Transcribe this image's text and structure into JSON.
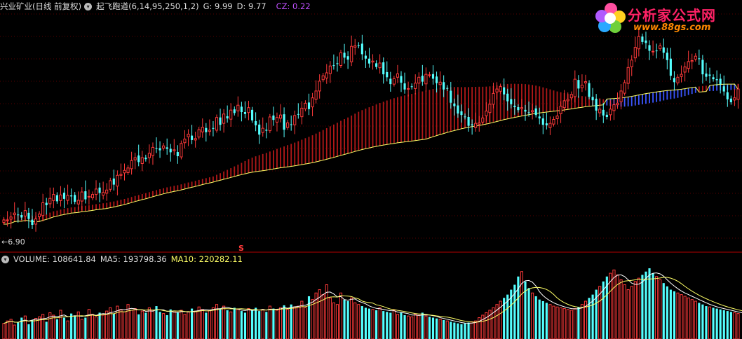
{
  "header": {
    "title": "兴业矿业(日线 前复权)",
    "indicator": "起飞跑道(6,14,95,250,1,2)",
    "g_label": "G: 9.99",
    "d_label": "D: 9.77",
    "cz_label": "CZ: 0.22"
  },
  "volume_header": {
    "volume_label": "VOLUME: 108641.84",
    "ma5_label": "MA5: 193798.36",
    "ma10_label": "MA10: 220282.11"
  },
  "price_panel": {
    "low_marker": "←6.90",
    "s_marker": "S"
  },
  "logo": {
    "title": "分析家公式网",
    "url": "www.88gs.com"
  },
  "colors": {
    "background": "#000000",
    "up": "#ff3a3a",
    "down": "#54ffff",
    "separator": "#b00000",
    "grid": "#5a0000",
    "ribbon_up": "#b01818",
    "ribbon_down": "#3a55ff",
    "ma_yellow": "#ffff66",
    "cz_purple": "#c050ff"
  },
  "chart_data": [
    {
      "type": "candlestick",
      "name": "兴业矿业(日线 前复权)",
      "ylim": [
        6.5,
        11.3
      ],
      "x": [
        1,
        2,
        3,
        4,
        5,
        6,
        7,
        8,
        9,
        10,
        11,
        12,
        13,
        14,
        15,
        16,
        17,
        18,
        19,
        20,
        21,
        22,
        23,
        24,
        25,
        26,
        27,
        28,
        29,
        30,
        31,
        32,
        33,
        34,
        35,
        36,
        37,
        38,
        39,
        40,
        41,
        42,
        43,
        44,
        45,
        46,
        47,
        48,
        49,
        50,
        51,
        52,
        53,
        54,
        55,
        56,
        57,
        58,
        59,
        60,
        61,
        62,
        63,
        64,
        65,
        66,
        67,
        68,
        69,
        70,
        71,
        72,
        73,
        74,
        75,
        76,
        77,
        78,
        79,
        80,
        81,
        82,
        83,
        84,
        85,
        86,
        87,
        88,
        89,
        90,
        91,
        92,
        93,
        94,
        95,
        96,
        97,
        98,
        99,
        100,
        101,
        102,
        103,
        104,
        105,
        106,
        107,
        108,
        109,
        110,
        111,
        112,
        113,
        114,
        115,
        116,
        117,
        118,
        119,
        120,
        121,
        122,
        123,
        124,
        125,
        126,
        127,
        128,
        129,
        130,
        131,
        132,
        133,
        134,
        135,
        136,
        137,
        138,
        139,
        140,
        141,
        142,
        143,
        144,
        145,
        146,
        147,
        148,
        149,
        150,
        151,
        152,
        153,
        154,
        155,
        156,
        157,
        158,
        159,
        160,
        161,
        162,
        163,
        164,
        165,
        166,
        167,
        168,
        169,
        170,
        171,
        172,
        173,
        174,
        175,
        176,
        177,
        178,
        179,
        180,
        181,
        182,
        183,
        184,
        185,
        186,
        187,
        188,
        189,
        190,
        191,
        192,
        193,
        194,
        195,
        196,
        197,
        198,
        199,
        200,
        201,
        202,
        203,
        204,
        205,
        206,
        207,
        208,
        209,
        210
      ],
      "close": [
        7.1,
        7.1,
        7.16,
        7.24,
        7.2,
        7.15,
        7.29,
        7.12,
        7.0,
        7.12,
        7.22,
        7.45,
        7.4,
        7.54,
        7.62,
        7.48,
        7.61,
        7.53,
        7.6,
        7.58,
        7.47,
        7.5,
        7.67,
        7.52,
        7.58,
        7.62,
        7.73,
        7.65,
        7.66,
        7.71,
        7.9,
        7.82,
        8.01,
        8.03,
        8.11,
        8.16,
        8.31,
        8.37,
        8.28,
        8.37,
        8.34,
        8.46,
        8.58,
        8.55,
        8.52,
        8.61,
        8.55,
        8.48,
        8.53,
        8.4,
        8.66,
        8.75,
        8.85,
        8.73,
        8.76,
        8.94,
        8.99,
        8.89,
        8.93,
        8.96,
        9.19,
        9.04,
        9.26,
        9.17,
        9.34,
        9.28,
        9.44,
        9.3,
        9.26,
        9.39,
        9.13,
        9.03,
        8.84,
        8.97,
        8.92,
        9.2,
        9.14,
        9.19,
        9.24,
        8.94,
        9.08,
        9.04,
        9.23,
        9.25,
        9.38,
        9.48,
        9.36,
        9.59,
        9.73,
        9.93,
        10.04,
        10.1,
        10.24,
        10.25,
        10.28,
        10.51,
        10.41,
        10.37,
        10.64,
        10.65,
        10.65,
        10.48,
        10.39,
        10.29,
        10.34,
        10.22,
        10.3,
        10.07,
        10.01,
        9.87,
        9.98,
        10.08,
        9.9,
        9.76,
        9.78,
        9.81,
        9.89,
        10.01,
        9.92,
        10.07,
        10.06,
        9.98,
        9.89,
        9.91,
        9.76,
        9.78,
        9.49,
        9.42,
        9.27,
        9.24,
        9.2,
        9.02,
        9.03,
        9.07,
        9.08,
        9.18,
        9.32,
        9.46,
        9.68,
        9.77,
        9.82,
        9.66,
        9.52,
        9.46,
        9.4,
        9.34,
        9.39,
        9.31,
        9.29,
        9.33,
        9.24,
        9.17,
        9.04,
        9.03,
        9.07,
        9.15,
        9.22,
        9.42,
        9.53,
        9.56,
        9.66,
        9.97,
        9.78,
        9.85,
        9.92,
        9.61,
        9.54,
        9.33,
        9.36,
        9.23,
        9.2,
        9.36,
        9.45,
        9.48,
        9.73,
        9.9,
        10.21,
        10.36,
        10.62,
        10.84,
        10.73,
        10.71,
        10.55,
        10.54,
        10.55,
        10.65,
        10.51,
        10.36,
        10.04,
        9.91,
        10.01,
        10.07,
        10.22,
        10.33,
        10.35,
        10.44,
        10.38,
        10.07,
        10.02,
        10.04,
        9.97,
        9.95,
        9.87,
        9.72,
        9.56,
        9.5,
        9.59,
        9.77
      ],
      "volume": [
        95000,
        110000,
        120000,
        85000,
        100000,
        130000,
        140000,
        90000,
        115000,
        125000,
        135000,
        150000,
        105000,
        160000,
        145000,
        120000,
        175000,
        130000,
        110000,
        155000,
        140000,
        165000,
        120000,
        130000,
        180000,
        150000,
        135000,
        160000,
        145000,
        170000,
        190000,
        155000,
        200000,
        180000,
        165000,
        210000,
        175000,
        185000,
        150000,
        170000,
        160000,
        190000,
        175000,
        200000,
        165000,
        155000,
        145000,
        180000,
        170000,
        160000,
        175000,
        150000,
        165000,
        185000,
        170000,
        195000,
        180000,
        160000,
        175000,
        190000,
        210000,
        185000,
        200000,
        175000,
        165000,
        190000,
        180000,
        170000,
        160000,
        185000,
        175000,
        190000,
        170000,
        180000,
        165000,
        200000,
        185000,
        175000,
        190000,
        205000,
        180000,
        210000,
        195000,
        200000,
        230000,
        190000,
        260000,
        240000,
        280000,
        300000,
        270000,
        330000,
        250000,
        220000,
        210000,
        280000,
        240000,
        230000,
        250000,
        220000,
        210000,
        200000,
        190000,
        185000,
        180000,
        175000,
        190000,
        170000,
        165000,
        160000,
        175000,
        150000,
        160000,
        145000,
        140000,
        135000,
        150000,
        145000,
        160000,
        140000,
        135000,
        130000,
        125000,
        120000,
        115000,
        110000,
        105000,
        100000,
        95000,
        90000,
        95000,
        100000,
        105000,
        110000,
        130000,
        145000,
        160000,
        175000,
        190000,
        210000,
        230000,
        250000,
        270000,
        300000,
        330000,
        380000,
        410000,
        350000,
        310000,
        280000,
        260000,
        240000,
        230000,
        220000,
        210000,
        200000,
        195000,
        190000,
        185000,
        180000,
        175000,
        185000,
        195000,
        210000,
        230000,
        250000,
        270000,
        300000,
        320000,
        350000,
        380000,
        400000,
        420000,
        390000,
        360000,
        330000,
        300000,
        320000,
        350000,
        370000,
        390000,
        410000,
        430000,
        400000,
        380000,
        360000,
        340000,
        320000,
        300000,
        290000,
        280000,
        270000,
        260000,
        250000,
        240000,
        230000,
        220000,
        210000,
        200000,
        195000,
        190000,
        185000,
        180000,
        175000,
        170000,
        165000,
        160000,
        155000,
        150000,
        145000
      ]
    }
  ]
}
